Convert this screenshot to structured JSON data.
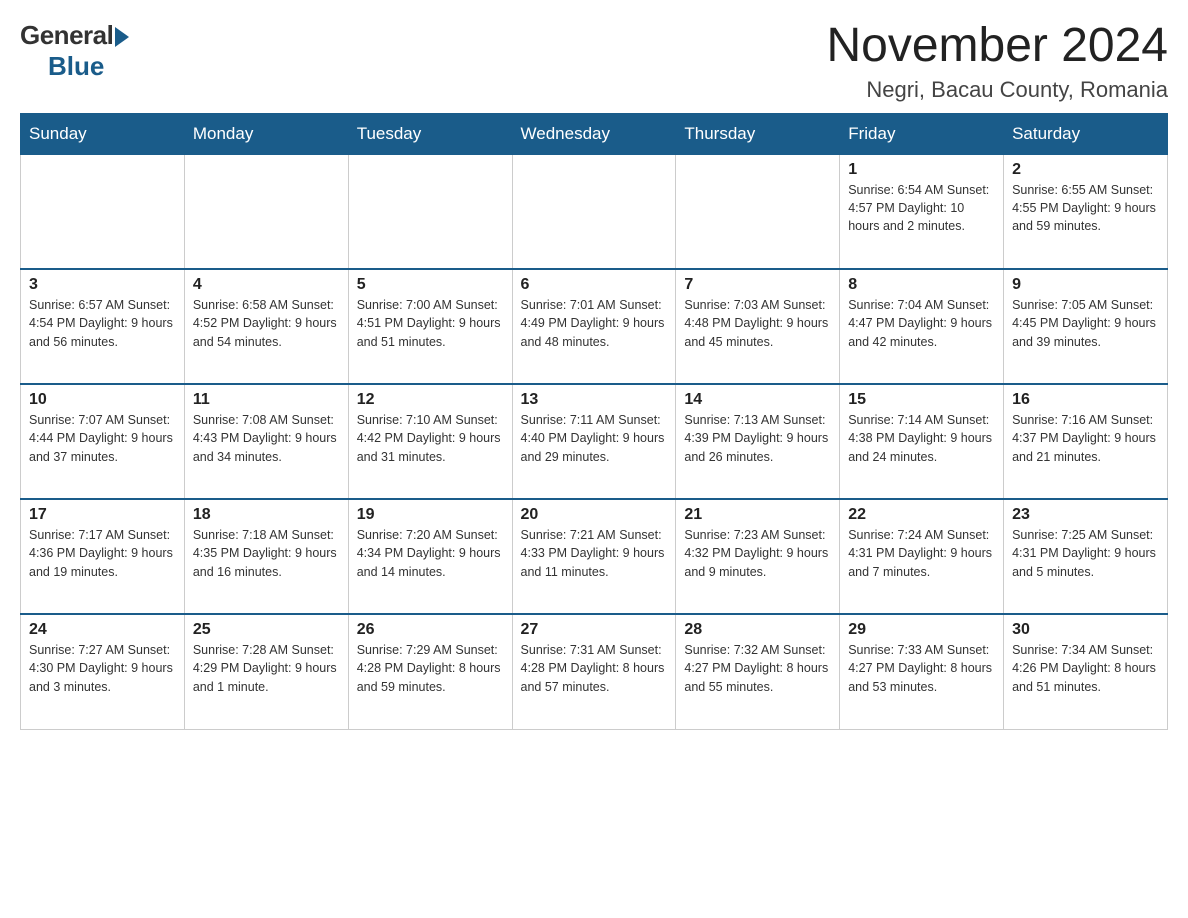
{
  "logo": {
    "general": "General",
    "blue": "Blue"
  },
  "title": "November 2024",
  "location": "Negri, Bacau County, Romania",
  "weekdays": [
    "Sunday",
    "Monday",
    "Tuesday",
    "Wednesday",
    "Thursday",
    "Friday",
    "Saturday"
  ],
  "weeks": [
    [
      {
        "day": "",
        "info": ""
      },
      {
        "day": "",
        "info": ""
      },
      {
        "day": "",
        "info": ""
      },
      {
        "day": "",
        "info": ""
      },
      {
        "day": "",
        "info": ""
      },
      {
        "day": "1",
        "info": "Sunrise: 6:54 AM\nSunset: 4:57 PM\nDaylight: 10 hours\nand 2 minutes."
      },
      {
        "day": "2",
        "info": "Sunrise: 6:55 AM\nSunset: 4:55 PM\nDaylight: 9 hours\nand 59 minutes."
      }
    ],
    [
      {
        "day": "3",
        "info": "Sunrise: 6:57 AM\nSunset: 4:54 PM\nDaylight: 9 hours\nand 56 minutes."
      },
      {
        "day": "4",
        "info": "Sunrise: 6:58 AM\nSunset: 4:52 PM\nDaylight: 9 hours\nand 54 minutes."
      },
      {
        "day": "5",
        "info": "Sunrise: 7:00 AM\nSunset: 4:51 PM\nDaylight: 9 hours\nand 51 minutes."
      },
      {
        "day": "6",
        "info": "Sunrise: 7:01 AM\nSunset: 4:49 PM\nDaylight: 9 hours\nand 48 minutes."
      },
      {
        "day": "7",
        "info": "Sunrise: 7:03 AM\nSunset: 4:48 PM\nDaylight: 9 hours\nand 45 minutes."
      },
      {
        "day": "8",
        "info": "Sunrise: 7:04 AM\nSunset: 4:47 PM\nDaylight: 9 hours\nand 42 minutes."
      },
      {
        "day": "9",
        "info": "Sunrise: 7:05 AM\nSunset: 4:45 PM\nDaylight: 9 hours\nand 39 minutes."
      }
    ],
    [
      {
        "day": "10",
        "info": "Sunrise: 7:07 AM\nSunset: 4:44 PM\nDaylight: 9 hours\nand 37 minutes."
      },
      {
        "day": "11",
        "info": "Sunrise: 7:08 AM\nSunset: 4:43 PM\nDaylight: 9 hours\nand 34 minutes."
      },
      {
        "day": "12",
        "info": "Sunrise: 7:10 AM\nSunset: 4:42 PM\nDaylight: 9 hours\nand 31 minutes."
      },
      {
        "day": "13",
        "info": "Sunrise: 7:11 AM\nSunset: 4:40 PM\nDaylight: 9 hours\nand 29 minutes."
      },
      {
        "day": "14",
        "info": "Sunrise: 7:13 AM\nSunset: 4:39 PM\nDaylight: 9 hours\nand 26 minutes."
      },
      {
        "day": "15",
        "info": "Sunrise: 7:14 AM\nSunset: 4:38 PM\nDaylight: 9 hours\nand 24 minutes."
      },
      {
        "day": "16",
        "info": "Sunrise: 7:16 AM\nSunset: 4:37 PM\nDaylight: 9 hours\nand 21 minutes."
      }
    ],
    [
      {
        "day": "17",
        "info": "Sunrise: 7:17 AM\nSunset: 4:36 PM\nDaylight: 9 hours\nand 19 minutes."
      },
      {
        "day": "18",
        "info": "Sunrise: 7:18 AM\nSunset: 4:35 PM\nDaylight: 9 hours\nand 16 minutes."
      },
      {
        "day": "19",
        "info": "Sunrise: 7:20 AM\nSunset: 4:34 PM\nDaylight: 9 hours\nand 14 minutes."
      },
      {
        "day": "20",
        "info": "Sunrise: 7:21 AM\nSunset: 4:33 PM\nDaylight: 9 hours\nand 11 minutes."
      },
      {
        "day": "21",
        "info": "Sunrise: 7:23 AM\nSunset: 4:32 PM\nDaylight: 9 hours\nand 9 minutes."
      },
      {
        "day": "22",
        "info": "Sunrise: 7:24 AM\nSunset: 4:31 PM\nDaylight: 9 hours\nand 7 minutes."
      },
      {
        "day": "23",
        "info": "Sunrise: 7:25 AM\nSunset: 4:31 PM\nDaylight: 9 hours\nand 5 minutes."
      }
    ],
    [
      {
        "day": "24",
        "info": "Sunrise: 7:27 AM\nSunset: 4:30 PM\nDaylight: 9 hours\nand 3 minutes."
      },
      {
        "day": "25",
        "info": "Sunrise: 7:28 AM\nSunset: 4:29 PM\nDaylight: 9 hours\nand 1 minute."
      },
      {
        "day": "26",
        "info": "Sunrise: 7:29 AM\nSunset: 4:28 PM\nDaylight: 8 hours\nand 59 minutes."
      },
      {
        "day": "27",
        "info": "Sunrise: 7:31 AM\nSunset: 4:28 PM\nDaylight: 8 hours\nand 57 minutes."
      },
      {
        "day": "28",
        "info": "Sunrise: 7:32 AM\nSunset: 4:27 PM\nDaylight: 8 hours\nand 55 minutes."
      },
      {
        "day": "29",
        "info": "Sunrise: 7:33 AM\nSunset: 4:27 PM\nDaylight: 8 hours\nand 53 minutes."
      },
      {
        "day": "30",
        "info": "Sunrise: 7:34 AM\nSunset: 4:26 PM\nDaylight: 8 hours\nand 51 minutes."
      }
    ]
  ]
}
